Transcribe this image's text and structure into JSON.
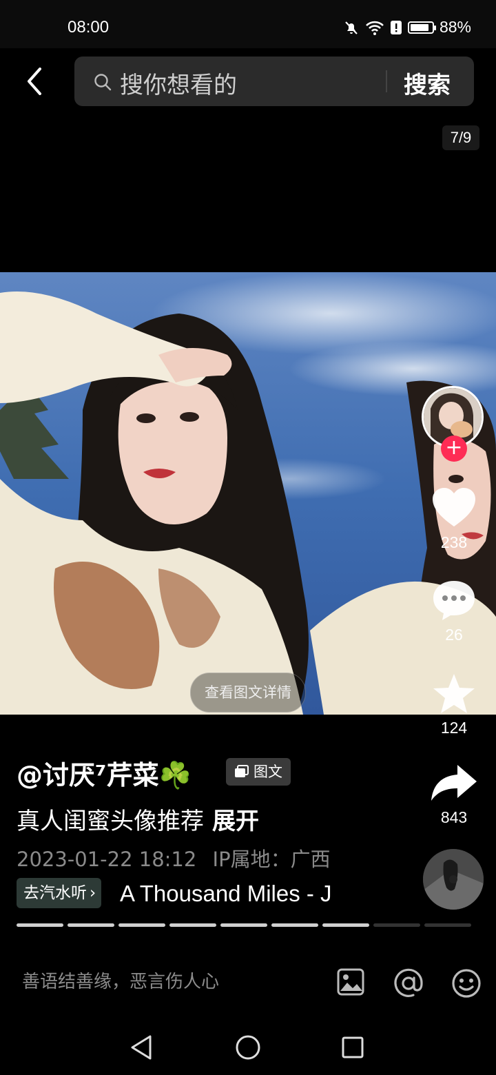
{
  "status_bar": {
    "time": "08:00",
    "battery": "88%"
  },
  "header": {
    "search_placeholder": "搜你想看的",
    "search_button": "搜索"
  },
  "pager": {
    "indicator": "7/9",
    "current": 7,
    "total": 9
  },
  "photo": {
    "view_details_label": "查看图文详情"
  },
  "rail": {
    "likes": "238",
    "comments": "26",
    "favorites": "124",
    "shares": "843"
  },
  "post": {
    "author": "@讨厌⁷芹菜☘️",
    "type_badge": "图文",
    "caption": "真人闺蜜头像推荐",
    "expand_label": "展开",
    "date": "2023-01-22 18:12",
    "ip_location": "IP属地：广西"
  },
  "music": {
    "chip_label": "去汽水听",
    "title": "A Thousand Miles - J"
  },
  "comment_bar": {
    "placeholder": "善语结善缘，恶言伤人心"
  },
  "colors": {
    "follow_red": "#fe2c55",
    "background": "#000000"
  }
}
